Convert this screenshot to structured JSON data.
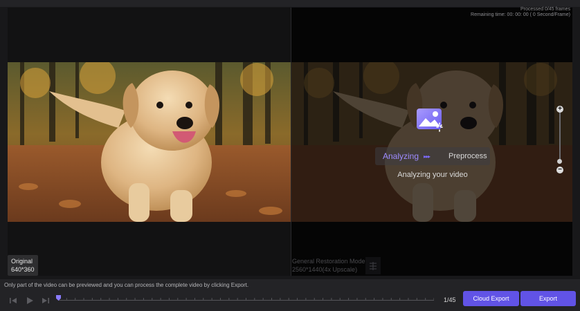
{
  "status": {
    "processed": "Processed 0/45 frames",
    "remaining": "Remaining time: 00: 00: 00 ( 0 Second/Frame)"
  },
  "analysis": {
    "step_active": "Analyzing",
    "step_next": "Preprocess",
    "message": "Analyzing your video"
  },
  "original_tag": {
    "title": "Original",
    "resolution": "640*360"
  },
  "model_tag": {
    "name": "General Restoration Model",
    "resolution": "2560*1440(4x Upscale)"
  },
  "hint": "Only part of the video can be previewed and you can process the complete video by clicking Export.",
  "playback": {
    "frame_counter": "1/45",
    "progress": 0.0
  },
  "buttons": {
    "cloud_export": "Cloud Export",
    "export": "Export"
  },
  "colors": {
    "accent": "#6153e6",
    "analyzing_text": "#9d8bff"
  },
  "icons": [
    "previous-frame-icon",
    "play-icon",
    "next-frame-icon",
    "zoom-in-icon",
    "zoom-out-icon",
    "image-analyzing-icon",
    "compare-icon"
  ]
}
